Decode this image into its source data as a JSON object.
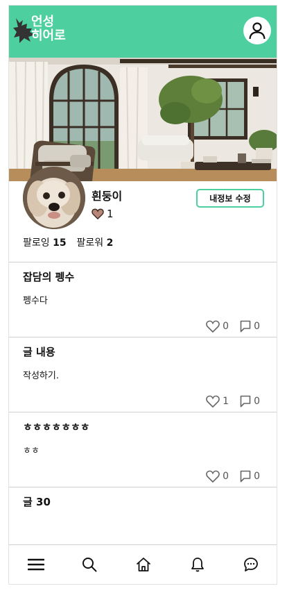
{
  "header": {
    "logo_line1": "언성",
    "logo_line2": "히어로",
    "brand_color": "#4ecfa0",
    "profile_icon": "user-icon"
  },
  "profile": {
    "nickname": "흰둥이",
    "likes_count": "1",
    "edit_button_label": "내정보 수정",
    "following_label": "팔로잉",
    "following_count": "15",
    "followers_label": "팔로워",
    "followers_count": "2"
  },
  "posts": [
    {
      "title": "잡담의 펭수",
      "body": "펭수다",
      "likes": "0",
      "comments": "0"
    },
    {
      "title": "글 내용",
      "body": "작성하기.",
      "likes": "1",
      "comments": "0"
    },
    {
      "title": "ㅎㅎㅎㅎㅎㅎㅎ",
      "body": "ㅎㅎ",
      "likes": "0",
      "comments": "0"
    },
    {
      "title": "글 30"
    }
  ],
  "nav": {
    "items": [
      "menu-icon",
      "search-icon",
      "home-icon",
      "bell-icon",
      "chat-icon"
    ]
  }
}
